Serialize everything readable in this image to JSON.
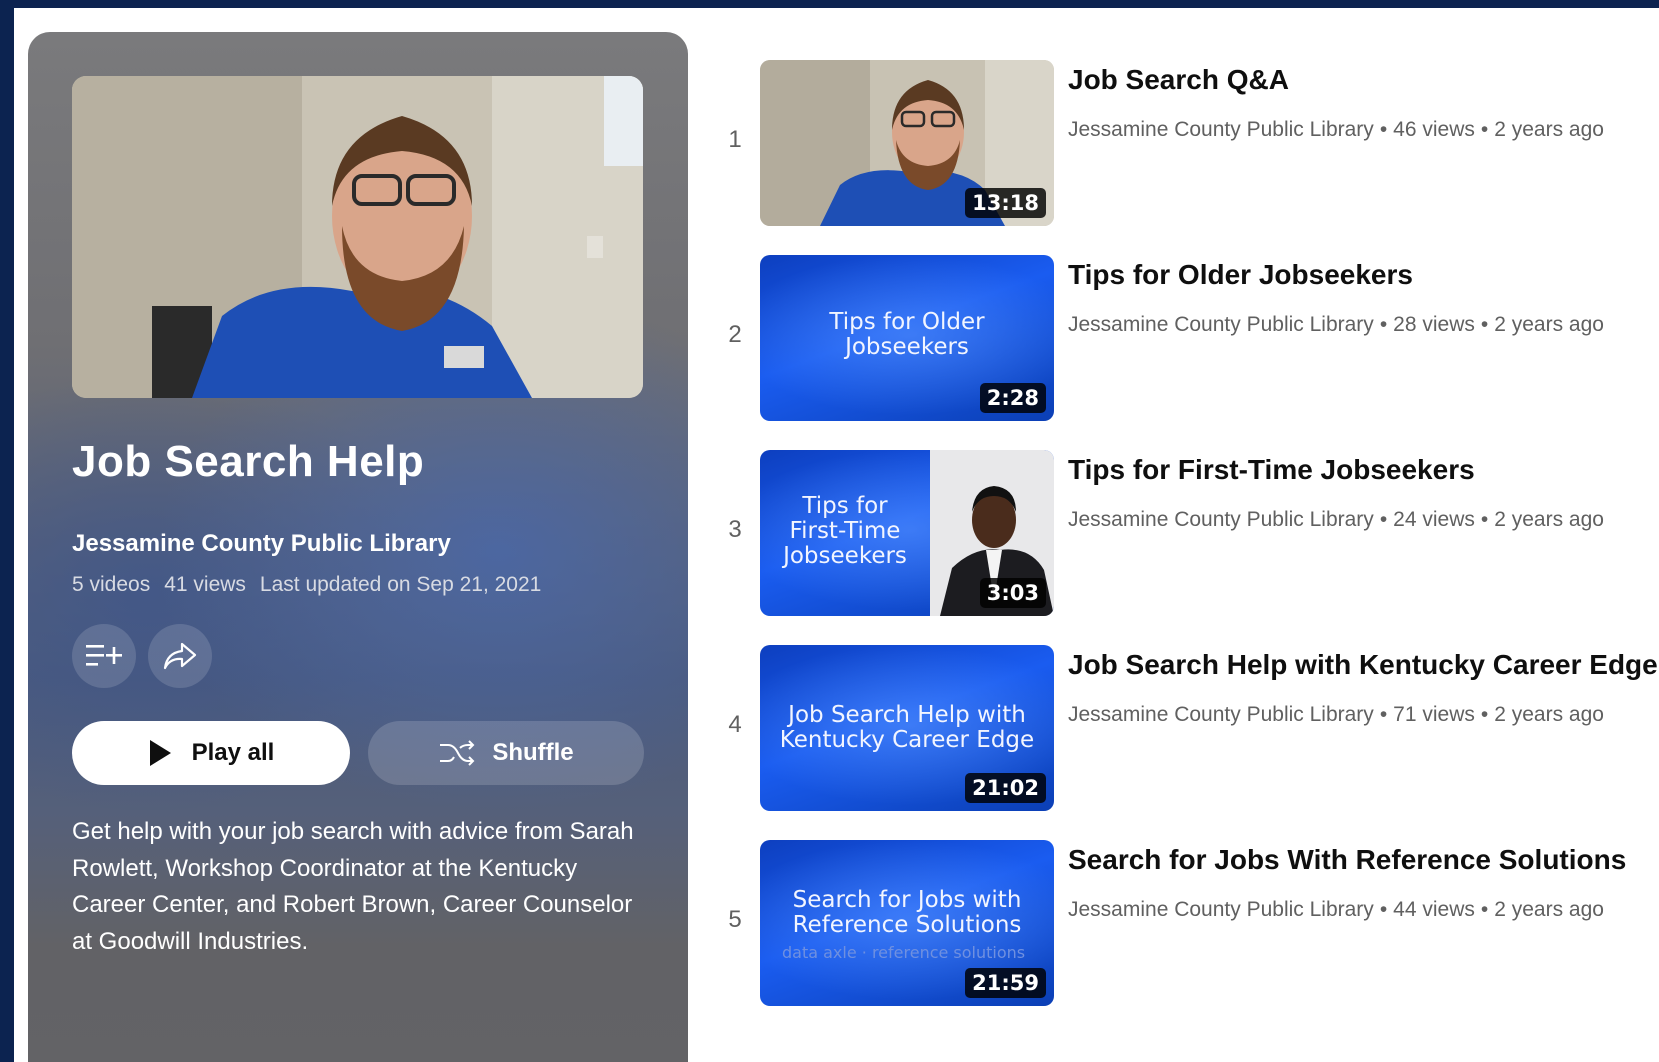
{
  "playlist": {
    "title": "Job Search Help",
    "channel": "Jessamine County Public Library",
    "video_count": "5 videos",
    "view_count": "41 views",
    "last_updated": "Last updated on Sep 21, 2021",
    "play_all_label": "Play all",
    "shuffle_label": "Shuffle",
    "description": "Get help with your job search with advice from Sarah Rowlett, Workshop Coordinator at the Kentucky Career Center, and Robert Brown, Career Counselor at Goodwill Industries."
  },
  "videos": [
    {
      "index": "1",
      "title": "Job Search Q&A",
      "channel": "Jessamine County Public Library",
      "views": "46 views",
      "age": "2 years ago",
      "duration": "13:18",
      "thumb_text": ""
    },
    {
      "index": "2",
      "title": "Tips for Older Jobseekers",
      "channel": "Jessamine County Public Library",
      "views": "28 views",
      "age": "2 years ago",
      "duration": "2:28",
      "thumb_text_line1": "Tips for Older",
      "thumb_text_line2": "Jobseekers"
    },
    {
      "index": "3",
      "title": "Tips for First-Time Jobseekers",
      "channel": "Jessamine County Public Library",
      "views": "24 views",
      "age": "2 years ago",
      "duration": "3:03",
      "thumb_text_line1": "Tips for",
      "thumb_text_line2": "First-Time",
      "thumb_text_line3": "Jobseekers"
    },
    {
      "index": "4",
      "title": "Job Search Help with Kentucky Career Edge",
      "channel": "Jessamine County Public Library",
      "views": "71 views",
      "age": "2 years ago",
      "duration": "21:02",
      "thumb_text_line1": "Job Search Help with",
      "thumb_text_line2": "Kentucky Career Edge"
    },
    {
      "index": "5",
      "title": "Search for Jobs With Reference Solutions",
      "channel": "Jessamine County Public Library",
      "views": "44 views",
      "age": "2 years ago",
      "duration": "21:59",
      "thumb_text_line1": "Search for Jobs with",
      "thumb_text_line2": "Reference Solutions",
      "thumb_sub_text": "data axle · reference solutions"
    }
  ],
  "colors": {
    "frame": "#0c2350",
    "thumb_blue": "#1a5cf0",
    "meta_gray": "#606060"
  }
}
